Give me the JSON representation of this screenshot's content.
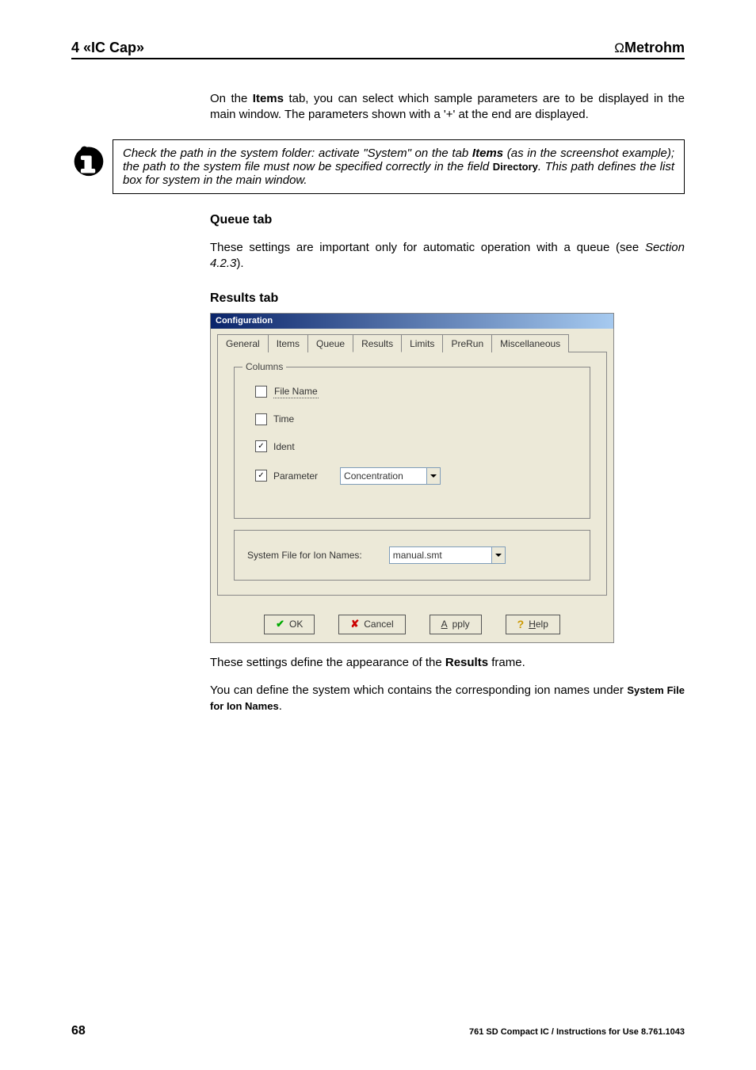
{
  "header": {
    "left": "4 «IC Cap»",
    "right_prefix": "Ω",
    "right_brand": "Metrohm"
  },
  "para1_pre": "On the ",
  "para1_bold": "Items",
  "para1_post": " tab, you can select which sample parameters are to be displayed in the main window. The parameters shown with a  '+' at the end are displayed.",
  "note": {
    "line1_pre": "Check the path in the system folder: activate \"System\" on the tab ",
    "line1_bold": "Items",
    "line2": "   (as in the screenshot example); the path to the system file must now be specified correctly in the field ",
    "dir": "Directory",
    "line3": ". This path defines the list box for system in the main window."
  },
  "queue": {
    "head": "Queue tab",
    "body_pre": "These settings are important only for automatic operation with a queue (see ",
    "body_it": "Section 4.2.3",
    "body_post": ")."
  },
  "results": {
    "head": "Results tab"
  },
  "dialog": {
    "title": "Configuration",
    "tabs": {
      "general": "General",
      "items": "Items",
      "queue": "Queue",
      "results": "Results",
      "limits": "Limits",
      "prerun": "PreRun",
      "misc": "Miscellaneous"
    },
    "columns_legend": "Columns",
    "cb_file": "File Name",
    "cb_time": "Time",
    "cb_ident": "Ident",
    "cb_param": "Parameter",
    "combo_param": "Concentration",
    "sysfile_label": "System File for Ion Names:",
    "sysfile_value": "manual.smt",
    "buttons": {
      "ok": "OK",
      "cancel": "Cancel",
      "apply": "Apply",
      "help_u": "H",
      "help_rest": "elp"
    }
  },
  "post1_pre": "These settings define the appearance of the ",
  "post1_bold": "Results",
  "post1_post": " frame.",
  "post2_pre": "You can define the system which contains the corresponding ion names under ",
  "post2_bold": "System File for Ion Names",
  "post2_post": ".",
  "footer": {
    "page": "68",
    "right": "761 SD Compact IC / Instructions for Use  8.761.1043"
  }
}
